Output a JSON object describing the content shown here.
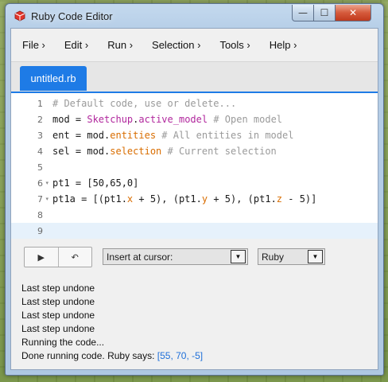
{
  "window": {
    "title": "Ruby Code Editor",
    "controls": {
      "minimize": "—",
      "maximize": "☐",
      "close": "✕"
    }
  },
  "menu": [
    {
      "label": "File ›"
    },
    {
      "label": "Edit ›"
    },
    {
      "label": "Run ›"
    },
    {
      "label": "Selection ›"
    },
    {
      "label": "Tools ›"
    },
    {
      "label": "Help ›"
    }
  ],
  "tabs": [
    {
      "label": "untitled.rb",
      "active": true
    }
  ],
  "editor": {
    "active_line": 9,
    "lines": [
      {
        "num": "1",
        "tokens": [
          {
            "t": "# Default code, use or delete...",
            "c": "comment"
          }
        ]
      },
      {
        "num": "2",
        "tokens": [
          {
            "t": "mod = ",
            "c": "plain"
          },
          {
            "t": "Sketchup",
            "c": "const"
          },
          {
            "t": ".",
            "c": "plain"
          },
          {
            "t": "active_model",
            "c": "const"
          },
          {
            "t": " # Open model",
            "c": "comment"
          }
        ]
      },
      {
        "num": "3",
        "tokens": [
          {
            "t": "ent = mod.",
            "c": "plain"
          },
          {
            "t": "entities",
            "c": "method"
          },
          {
            "t": " # All entities in model",
            "c": "comment"
          }
        ]
      },
      {
        "num": "4",
        "tokens": [
          {
            "t": "sel = mod.",
            "c": "plain"
          },
          {
            "t": "selection",
            "c": "method"
          },
          {
            "t": " # Current selection",
            "c": "comment"
          }
        ]
      },
      {
        "num": "5",
        "tokens": []
      },
      {
        "num": "6",
        "fold": true,
        "tokens": [
          {
            "t": "pt1 = [50,65,0]",
            "c": "plain"
          }
        ]
      },
      {
        "num": "7",
        "fold": true,
        "tokens": [
          {
            "t": "pt1a = [(pt1.",
            "c": "plain"
          },
          {
            "t": "x",
            "c": "method"
          },
          {
            "t": " + 5), (pt1.",
            "c": "plain"
          },
          {
            "t": "y",
            "c": "method"
          },
          {
            "t": " + 5), (pt1.",
            "c": "plain"
          },
          {
            "t": "z",
            "c": "method"
          },
          {
            "t": " - 5)]",
            "c": "plain"
          }
        ]
      },
      {
        "num": "8",
        "tokens": []
      },
      {
        "num": "9",
        "tokens": []
      }
    ]
  },
  "toolbar": {
    "run_icon": "▶",
    "undo_icon": "↶",
    "insert_select": "Insert at cursor:",
    "language_select": "Ruby"
  },
  "console": {
    "lines": [
      {
        "text": "Last step undone"
      },
      {
        "text": "Last step undone"
      },
      {
        "text": "Last step undone"
      },
      {
        "text": "Last step undone"
      },
      {
        "text": "Running the code..."
      },
      {
        "text": "Done running code. Ruby says: ",
        "result": "[55, 70, -5]"
      }
    ]
  },
  "colors": {
    "accent": "#1e7be6",
    "comment": "#9a9a9a",
    "constant": "#b1279d",
    "method": "#d96d00",
    "result": "#1e6fd9"
  }
}
